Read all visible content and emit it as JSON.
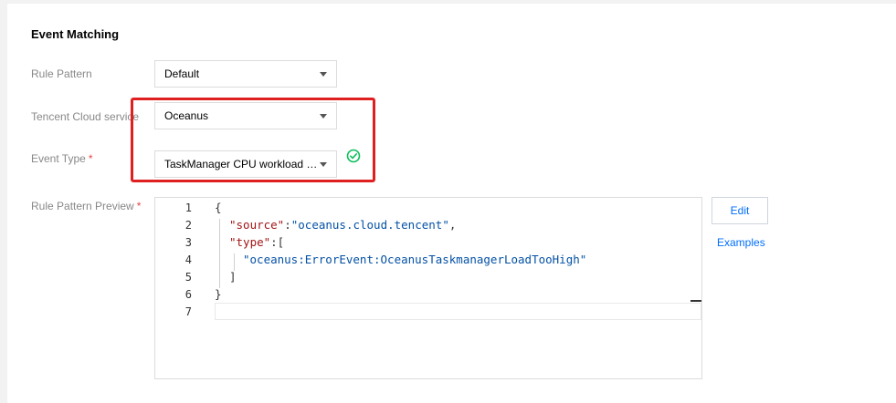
{
  "section": {
    "title": "Event Matching"
  },
  "form": {
    "rule_pattern": {
      "label": "Rule Pattern",
      "value": "Default"
    },
    "cloud_service": {
      "label": "Tencent Cloud service",
      "value": "Oceanus"
    },
    "event_type": {
      "label": "Event Type",
      "required_mark": "*",
      "value": "TaskManager CPU workload is too high"
    },
    "preview": {
      "label": "Rule Pattern Preview",
      "required_mark": "*"
    }
  },
  "editor": {
    "line_numbers": [
      "1",
      "2",
      "3",
      "4",
      "5",
      "6",
      "7"
    ],
    "lines": {
      "l1": "{",
      "l2_key": "\"source\"",
      "l2_colon": ":",
      "l2_val": "\"oceanus.cloud.tencent\"",
      "l2_end": ",",
      "l3_key": "\"type\"",
      "l3_rest": ":[",
      "l4_val": "\"oceanus:ErrorEvent:OceanusTaskmanagerLoadTooHigh\"",
      "l5": "]",
      "l6": "}"
    }
  },
  "actions": {
    "edit_label": "Edit",
    "examples_label": "Examples"
  },
  "colors": {
    "accent": "#006eff",
    "highlight": "#e02020",
    "success": "#0abf5b"
  },
  "icons": {
    "status": "check-circle-icon",
    "dropdown": "caret-down-icon"
  }
}
